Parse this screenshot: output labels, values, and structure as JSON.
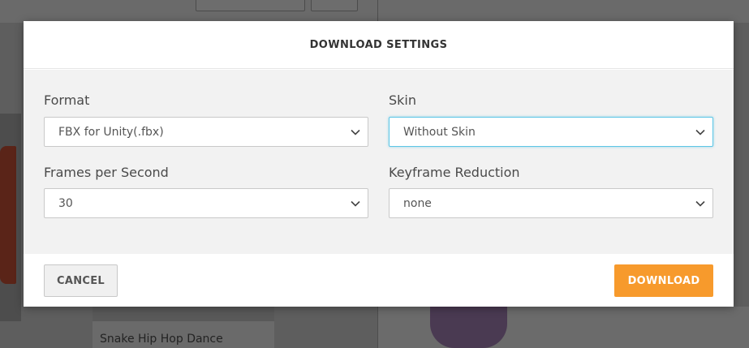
{
  "background": {
    "card_title": "Snake Hip Hop Dance"
  },
  "modal": {
    "title": "DOWNLOAD SETTINGS",
    "fields": {
      "format": {
        "label": "Format",
        "value": "FBX for Unity(.fbx)"
      },
      "skin": {
        "label": "Skin",
        "value": "Without Skin"
      },
      "fps": {
        "label": "Frames per Second",
        "value": "30"
      },
      "keyframe_reduction": {
        "label": "Keyframe Reduction",
        "value": "none"
      }
    },
    "buttons": {
      "cancel": "CANCEL",
      "download": "DOWNLOAD"
    }
  },
  "colors": {
    "accent": "#f79a2c",
    "focus": "#5ec6e6"
  },
  "icons": [
    "chevron-down-icon"
  ]
}
